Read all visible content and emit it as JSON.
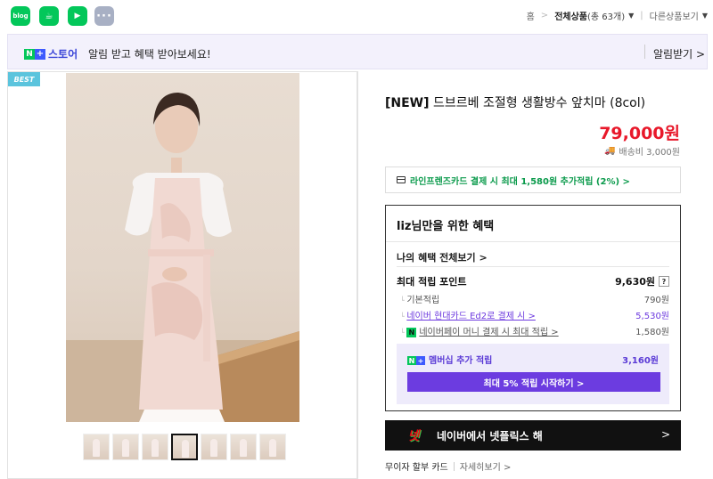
{
  "topbar": {
    "apps": [
      {
        "name": "blog",
        "glyph": "blog"
      },
      {
        "name": "cafe",
        "glyph": "☕"
      },
      {
        "name": "book",
        "glyph": "▶"
      },
      {
        "name": "more",
        "glyph": "···"
      }
    ],
    "breadcrumb": {
      "home": "홈",
      "all": "전체상품",
      "count": "(총 63개)",
      "other": "다른상품보기"
    }
  },
  "notice": {
    "store_label": "스토어",
    "text": "알림 받고 혜택 받아보세요!",
    "button": "알림받기 >"
  },
  "gallery": {
    "badge": "BEST",
    "thumb_count": 7,
    "selected_index": 3
  },
  "product": {
    "title_tag": "[NEW]",
    "title": " 드브르베 조절형 생활방수 앞치마 (8col)",
    "price": "79,000원",
    "shipping": "배송비 3,000원",
    "card_promo": "라인프렌즈카드 결제 시 최대 1,580원 추가적립 (2%) >"
  },
  "benefit": {
    "heading": "liz님만을 위한 혜택",
    "all_link": "나의 혜택 전체보기 >",
    "max_label": "최대 적립 포인트",
    "max_value": "9,630원",
    "help": "?",
    "rows": [
      {
        "label": "기본적립",
        "value": "790원"
      },
      {
        "label": "네이버 현대카드 Ed2로 결제 시 >",
        "value": "5,530원"
      },
      {
        "label": "네이버페이 머니 결제 시 최대 적립 >",
        "value": "1,580원"
      }
    ],
    "npay_glyph": "N",
    "membership_label": "멤버십 추가 적립",
    "membership_value": "3,160원",
    "start_button": "최대 5% 적립 시작하기 >"
  },
  "netflix": {
    "logo": "넷",
    "text": "네이버에서 넷플릭스 해",
    "arrow": ">"
  },
  "cardinfo": {
    "label": "무이자 할부 카드",
    "more": "자세히보기 >"
  },
  "colors": {
    "naver_green": "#03c75a",
    "price_red": "#e8182a",
    "membership_purple": "#6c3ce0"
  }
}
